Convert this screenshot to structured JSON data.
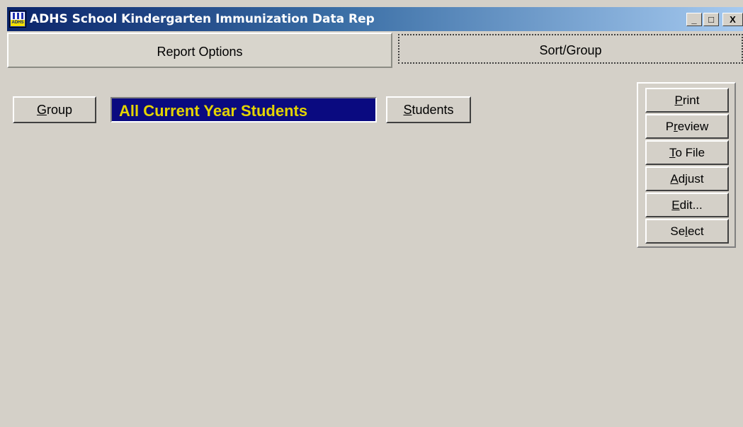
{
  "window": {
    "title": "ADHS School Kindergarten Immunization Data Rep",
    "icon": "app-logo-icon",
    "icon_text": "ADHS",
    "controls": {
      "minimize": "_",
      "maximize": "□",
      "close": "X"
    }
  },
  "tabs": [
    {
      "label": "Report Options",
      "selected": true
    },
    {
      "label": "Sort/Group",
      "selected": false
    }
  ],
  "report_options": {
    "group_button": {
      "mnemonic": "G",
      "rest": "roup"
    },
    "group_value": "All Current Year Students",
    "students_button": {
      "mnemonic": "S",
      "rest": "tudents"
    }
  },
  "actions": [
    {
      "pre": "",
      "mnemonic": "P",
      "post": "rint"
    },
    {
      "pre": "P",
      "mnemonic": "r",
      "post": "eview"
    },
    {
      "pre": "",
      "mnemonic": "T",
      "post": "o File"
    },
    {
      "pre": "",
      "mnemonic": "A",
      "post": "djust"
    },
    {
      "pre": "",
      "mnemonic": "E",
      "post": "dit..."
    },
    {
      "pre": "Se",
      "mnemonic": "l",
      "post": "ect"
    }
  ],
  "colors": {
    "face": "#d4d0c8",
    "title_gradient_start": "#0a246a",
    "title_gradient_end": "#a6caf0",
    "group_bg": "#0a0a80",
    "group_text": "#e4d400"
  }
}
